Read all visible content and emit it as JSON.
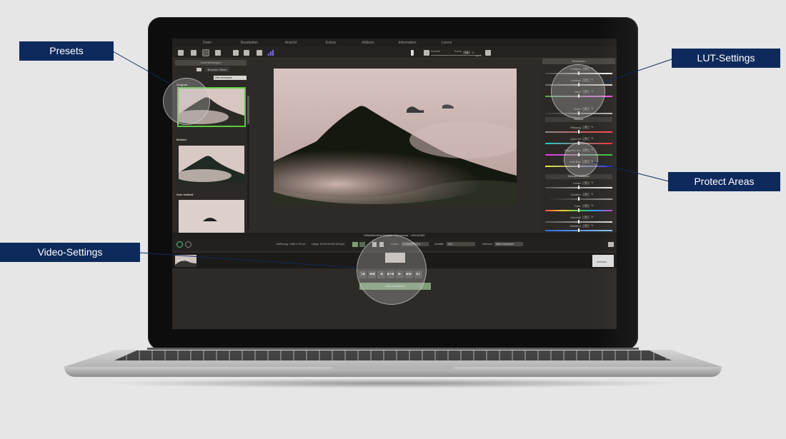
{
  "app": {
    "menu": [
      "Datei",
      "Bearbeiten",
      "Ansicht",
      "Extras",
      "Addons",
      "Information",
      "Lizenz"
    ],
    "toolbar": {
      "view_label": "Ansicht",
      "zoom_label": "Zoom",
      "zoom_value": "Fit",
      "zoom_unit": "%",
      "grid_label": "groß"
    },
    "left_panel": {
      "title": "Voreinstellungen",
      "browse_button": "Browser öffnen",
      "filter_select": "Alle anzeigen",
      "presets": [
        {
          "name": "Original",
          "selected": true
        },
        {
          "name": "Brillant",
          "selected": false
        },
        {
          "name": "Sehr brillant",
          "selected": false
        }
      ]
    },
    "right_panel": {
      "title": "Bearbeiten",
      "sliders": [
        {
          "label": "Helligkeit",
          "value": "0",
          "unit": "%"
        },
        {
          "label": "Kontrast",
          "value": "0",
          "unit": "%"
        },
        {
          "label": "Rotor",
          "value": "0",
          "unit": "%"
        },
        {
          "label": "Tiefen",
          "value": "0",
          "unit": "%"
        },
        {
          "label": "Sättigung",
          "value": "0",
          "unit": "%"
        },
        {
          "label": "Cyan-Rot",
          "value": "0",
          "unit": "%"
        },
        {
          "label": "Magenta-Grün",
          "value": "0",
          "unit": "%"
        },
        {
          "label": "Gelb-Blau",
          "value": "0",
          "unit": "%"
        },
        {
          "label": "Lichter",
          "value": "0",
          "unit": "%"
        },
        {
          "label": "Schatten",
          "value": "0",
          "unit": "%"
        },
        {
          "label": "Farbe",
          "value": "0",
          "unit": "%"
        },
        {
          "label": "Intensität",
          "value": "0",
          "unit": "%"
        },
        {
          "label": "Mitteltöne",
          "value": "0",
          "unit": "%"
        }
      ],
      "section_buttons": [
        "Balance",
        "Bereiche schützen"
      ]
    },
    "video": {
      "title": "Mittelalterliche Burgen · Panorama · 1920x1080",
      "resolution": "Auflösung: 1280 x 720 px",
      "length": "Länge: 00:00:26.000 (30 fps)",
      "codec_label": "Codec:",
      "codec_value": "H.264/MPEG-4",
      "quality_label": "Qualität:",
      "quality_value": "Gut",
      "interlace_label": "Interlace:",
      "interlace_value": "Nicht interlaced",
      "transport": [
        "|◀",
        "◀◀",
        "◀",
        "▶|◀",
        "▶",
        "▶▶",
        "▶|"
      ],
      "export_button": "Video exportieren",
      "start_thumb_label": "00:00:00.000"
    }
  },
  "callouts": {
    "presets": "Presets",
    "lut_settings": "LUT-Settings",
    "protect_areas": "Protect Areas",
    "video_settings": "Video-Settings"
  },
  "colors": {
    "callout_bg": "#0e2a5c",
    "selection_green": "#5ccc3e",
    "export_green": "#7e9e76",
    "app_bg": "#2d2a28"
  }
}
